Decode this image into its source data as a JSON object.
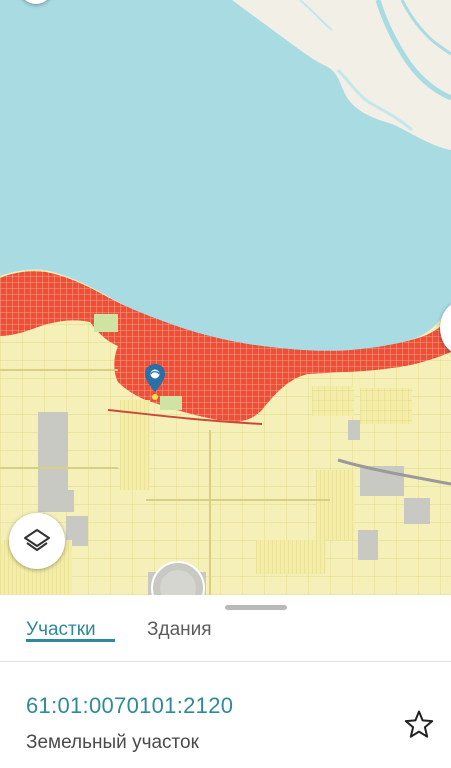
{
  "map": {
    "colors": {
      "sea": "#a9dbe3",
      "land": "#f1efe6",
      "parcel": "#f5f0b8",
      "parcel_edge": "#ddd37a",
      "dense_parcels": "#ee4f35",
      "marker": "#2a6fa6"
    },
    "icons": [
      "layers-icon",
      "location-pin-icon"
    ]
  },
  "sheet": {
    "tabs": [
      {
        "label": "Участки",
        "active": true
      },
      {
        "label": "Здания",
        "active": false
      }
    ],
    "parcel": {
      "cadastral_number": "61:01:0070101:2120",
      "type": "Земельный участок",
      "favorite_icon": "star-outline-icon"
    }
  }
}
